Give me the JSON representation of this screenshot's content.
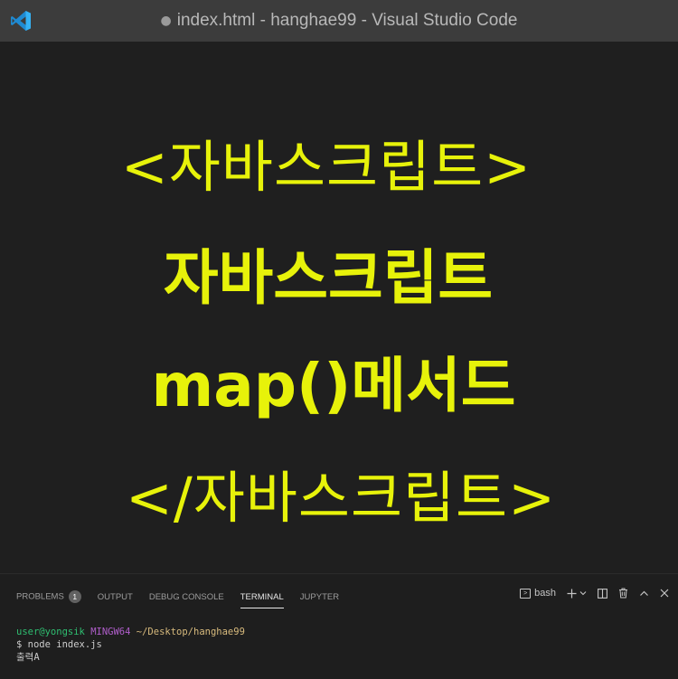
{
  "window": {
    "modified_dot": "●",
    "title": "index.html - hanghae99 - Visual Studio Code",
    "logo_icon": "vscode-logo-icon",
    "accent_color": "#23a9f2"
  },
  "editor": {
    "text_color": "#e7f20a",
    "lines": [
      "<자바스크립트>",
      "자바스크립트",
      "map()메서드",
      "</자바스크립트>"
    ]
  },
  "panel": {
    "tabs": [
      {
        "label": "PROBLEMS",
        "badge": "1"
      },
      {
        "label": "OUTPUT"
      },
      {
        "label": "DEBUG CONSOLE"
      },
      {
        "label": "TERMINAL",
        "active": true
      },
      {
        "label": "JUPYTER"
      }
    ],
    "actions": {
      "shell_label": "bash",
      "shell_icon": "terminal-icon",
      "add_icon": "plus-icon",
      "dropdown_icon": "chevron-down-icon",
      "split_icon": "split-icon",
      "trash_icon": "trash-icon",
      "maximize_icon": "chevron-up-icon",
      "close_icon": "close-icon"
    }
  },
  "terminal": {
    "user": "user@yongsik",
    "host": "MINGW64",
    "path": "~/Desktop/hanghae99",
    "command": "$ node index.js",
    "output": "출력A"
  }
}
